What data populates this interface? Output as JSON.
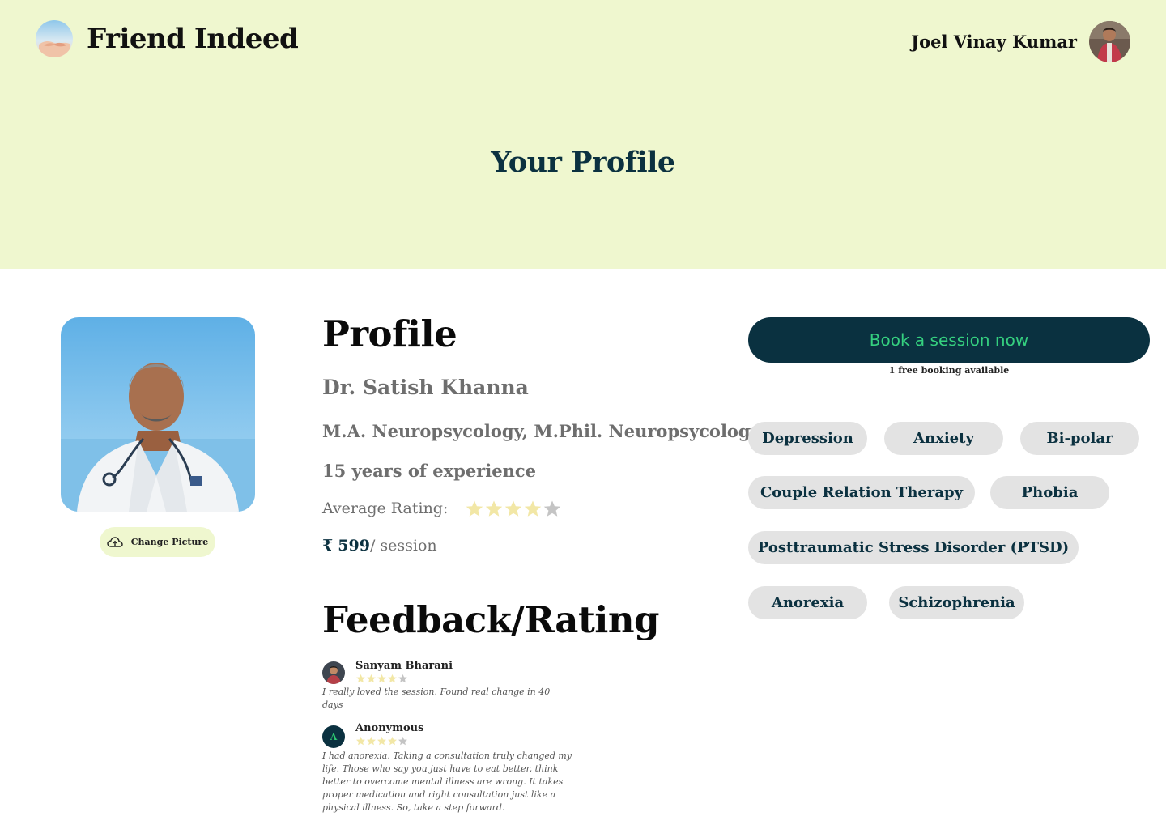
{
  "header": {
    "brand_name": "Friend Indeed",
    "user_name": "Joel Vinay Kumar"
  },
  "hero": {
    "title": "Your Profile"
  },
  "profile": {
    "heading": "Profile",
    "name": "Dr. Satish Khanna",
    "qualification": "M.A. Neuropsycology, M.Phil. Neuropsycology",
    "experience": "15 years of experience",
    "rating_label": "Average Rating:",
    "rating": 4,
    "rating_max": 5,
    "currency_symbol": "₹",
    "price": "599",
    "price_suffix": "/ session",
    "change_picture_label": "Change Picture"
  },
  "booking": {
    "button_label": "Book a session now",
    "note": "1 free booking available"
  },
  "specializations": [
    "Depression",
    "Anxiety",
    "Bi-polar",
    "Couple Relation Therapy",
    "Phobia",
    "Posttraumatic Stress Disorder (PTSD)",
    "Anorexia",
    "Schizophrenia"
  ],
  "feedback": {
    "heading": "Feedback/Rating",
    "reviews": [
      {
        "name": "Sanyam Bharani",
        "rating": 4,
        "text": "I really loved the session. Found real change  in 40 days"
      },
      {
        "name": "Anonymous",
        "avatar_letter": "A",
        "rating": 4,
        "text": "I had anorexia. Taking a consultation truly changed my life. Those who say you just have to eat better, think better to overcome mental illness are wrong. It takes proper medication and right consultation just like a physical illness. So, take a step forward."
      }
    ]
  },
  "colors": {
    "hero_bg": "#eff7cf",
    "accent_dark": "#0b3140",
    "accent_green": "#35d07f",
    "star_filled": "#f2e7a6",
    "star_empty": "#c4c4c4",
    "chip_bg": "#e3e3e3"
  },
  "icons": {
    "brand": "holding-hands-logo-icon",
    "change_picture": "cloud-upload-icon",
    "star": "star-icon"
  }
}
